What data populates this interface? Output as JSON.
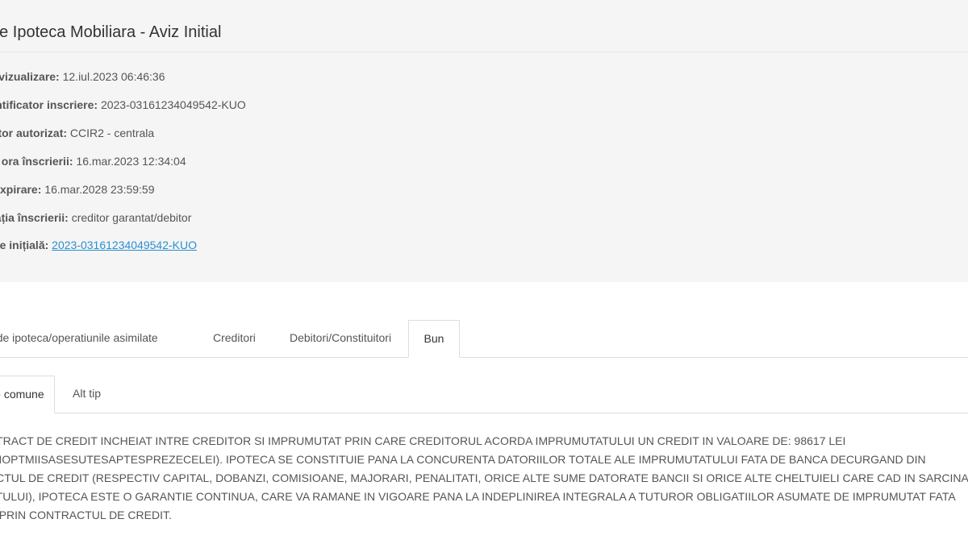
{
  "header": {
    "title": "Aviz de Ipoteca Mobiliara - Aviz Initial"
  },
  "info": [
    {
      "label": "Data vizualizare:",
      "value": "12.iul.2023 06:46:36"
    },
    {
      "label": "Identificator inscriere:",
      "value": "2023-03161234049542-KUO"
    },
    {
      "label": "Operator autorizat:",
      "value": "CCIR2 - centrala"
    },
    {
      "label": "Data și ora înscrierii:",
      "value": "16.mar.2023 12:34:04"
    },
    {
      "label": "Data expirare:",
      "value": "16.mar.2028 23:59:59"
    },
    {
      "label": "Destinația înscrierii:",
      "value": "creditor garantat/debitor"
    }
  ],
  "initial": {
    "label": "Inscriere inițială:",
    "link": "2023-03161234049542-KUO"
  },
  "main_tabs": [
    {
      "label": "Contractul de ipoteca/operatiunile asimilate",
      "active": false
    },
    {
      "label": "Creditori",
      "active": false
    },
    {
      "label": "Debitori/Constituitori",
      "active": false
    },
    {
      "label": "Bun",
      "active": true
    }
  ],
  "sub_tabs": [
    {
      "label": "Date comune",
      "active": true
    },
    {
      "label": "Alt tip",
      "active": false
    }
  ],
  "description": [
    "CONTRACT DE CREDIT INCHEIAT INTRE CREDITOR SI IMPRUMUTAT PRIN CARE CREDITORUL ACORDA IMPRUMUTATULUI UN CREDIT IN VALOARE DE: 98617 LEI",
    "(NOUAZECISIOPTMIISASESUTESAPTESPREZECELEI). IPOTECA SE CONSTITUIE PANA LA CONCURENTA DATORIILOR TOTALE ALE IMPRUMUTATULUI FATA DE BANCA DECURGAND DIN",
    "CONTRACTUL DE CREDIT (RESPECTIV CAPITAL, DOBANZI, COMISIOANE, MAJORARI, PENALITATI, ORICE ALTE SUME DATORATE BANCII SI ORICE ALTE CHELTUIELI CARE CAD IN SARCINA",
    "IMPRUMUTATULUI), IPOTECA ESTE O GARANTIE CONTINUA, CARE VA RAMANE IN VIGOARE PANA LA INDEPLINIREA INTEGRALA A TUTUROR OBLIGATIILOR ASUMATE DE IMPRUMUTAT FATA",
    "DE BANCA PRIN CONTRACTUL DE CREDIT."
  ]
}
